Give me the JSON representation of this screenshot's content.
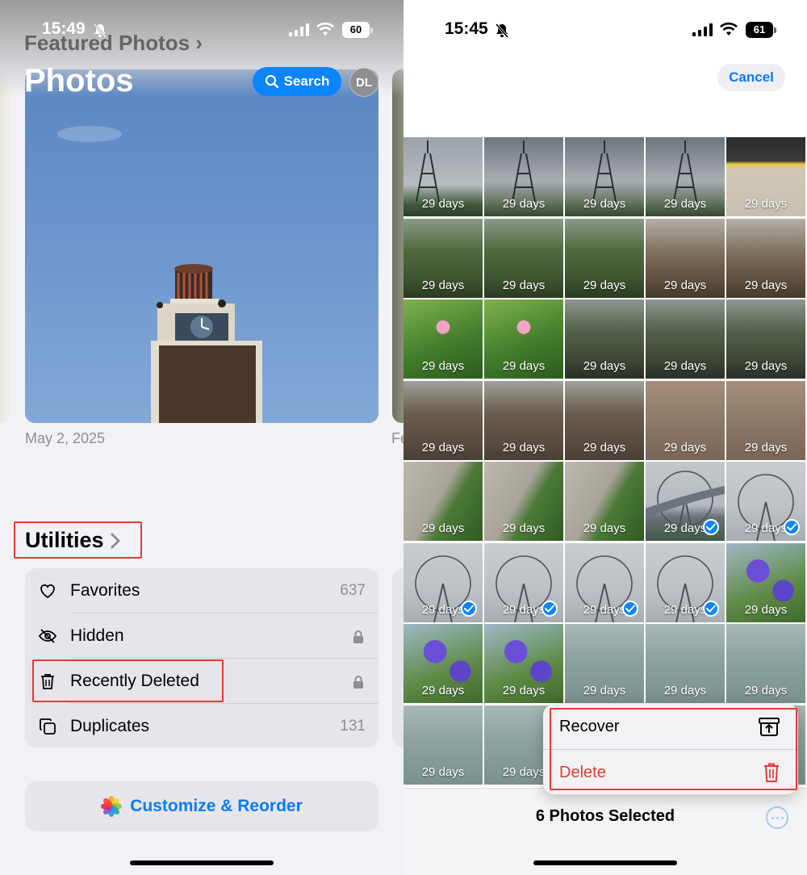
{
  "left": {
    "status": {
      "time": "15:49",
      "battery": "60"
    },
    "featured_title": "Featured Photos",
    "title": "Photos",
    "search_label": "Search",
    "avatar_initials": "DL",
    "feature_date": "May 2, 2025",
    "feature_date_next": "Fe",
    "utilities_title": "Utilities",
    "utilities": [
      {
        "label": "Favorites",
        "value": "637",
        "icon": "heart-icon"
      },
      {
        "label": "Hidden",
        "value": "",
        "icon": "eye-slash-icon",
        "locked": true
      },
      {
        "label": "Recently Deleted",
        "value": "",
        "icon": "trash-icon",
        "locked": true
      },
      {
        "label": "Duplicates",
        "value": "131",
        "icon": "duplicate-icon"
      }
    ],
    "customize_label": "Customize & Reorder"
  },
  "right": {
    "status": {
      "time": "15:45",
      "battery": "61"
    },
    "cancel_label": "Cancel",
    "days_label": "29 days",
    "photos": [
      {
        "kind": "tower-far",
        "checked": false
      },
      {
        "kind": "tower",
        "checked": false
      },
      {
        "kind": "tower",
        "checked": false
      },
      {
        "kind": "tower",
        "checked": false
      },
      {
        "kind": "floor",
        "checked": false
      },
      {
        "kind": "trees",
        "checked": false
      },
      {
        "kind": "trees",
        "checked": false
      },
      {
        "kind": "trees",
        "checked": false
      },
      {
        "kind": "bare-trees",
        "checked": false
      },
      {
        "kind": "bare-trees",
        "checked": false
      },
      {
        "kind": "flower-pink",
        "checked": false
      },
      {
        "kind": "flower-pink",
        "checked": false
      },
      {
        "kind": "dark-trees",
        "checked": false
      },
      {
        "kind": "dark-trees",
        "checked": false
      },
      {
        "kind": "dark-trees",
        "checked": false
      },
      {
        "kind": "brush",
        "checked": false
      },
      {
        "kind": "brush",
        "checked": false
      },
      {
        "kind": "brush",
        "checked": false
      },
      {
        "kind": "leaves",
        "checked": false
      },
      {
        "kind": "leaves",
        "checked": false
      },
      {
        "kind": "path",
        "checked": false
      },
      {
        "kind": "path",
        "checked": false
      },
      {
        "kind": "path",
        "checked": false
      },
      {
        "kind": "wheel-bridge",
        "checked": true
      },
      {
        "kind": "wheel",
        "checked": true
      },
      {
        "kind": "wheel",
        "checked": true
      },
      {
        "kind": "wheel",
        "checked": true
      },
      {
        "kind": "wheel",
        "checked": true
      },
      {
        "kind": "wheel",
        "checked": true
      },
      {
        "kind": "flower-purple",
        "checked": false
      },
      {
        "kind": "flower-purple",
        "checked": false
      },
      {
        "kind": "flower-purple",
        "checked": false
      },
      {
        "kind": "water",
        "checked": false
      },
      {
        "kind": "water",
        "checked": false
      },
      {
        "kind": "water",
        "checked": false
      },
      {
        "kind": "water",
        "checked": false
      },
      {
        "kind": "water",
        "checked": false
      },
      {
        "kind": "water",
        "checked": false
      },
      {
        "kind": "water",
        "checked": false
      },
      {
        "kind": "water",
        "checked": false
      }
    ],
    "menu": {
      "recover_label": "Recover",
      "delete_label": "Delete"
    },
    "selected_label": "6 Photos Selected"
  },
  "colors": {
    "accent": "#0a84ff",
    "destructive": "#e53935",
    "highlight_box": "#e53935"
  }
}
